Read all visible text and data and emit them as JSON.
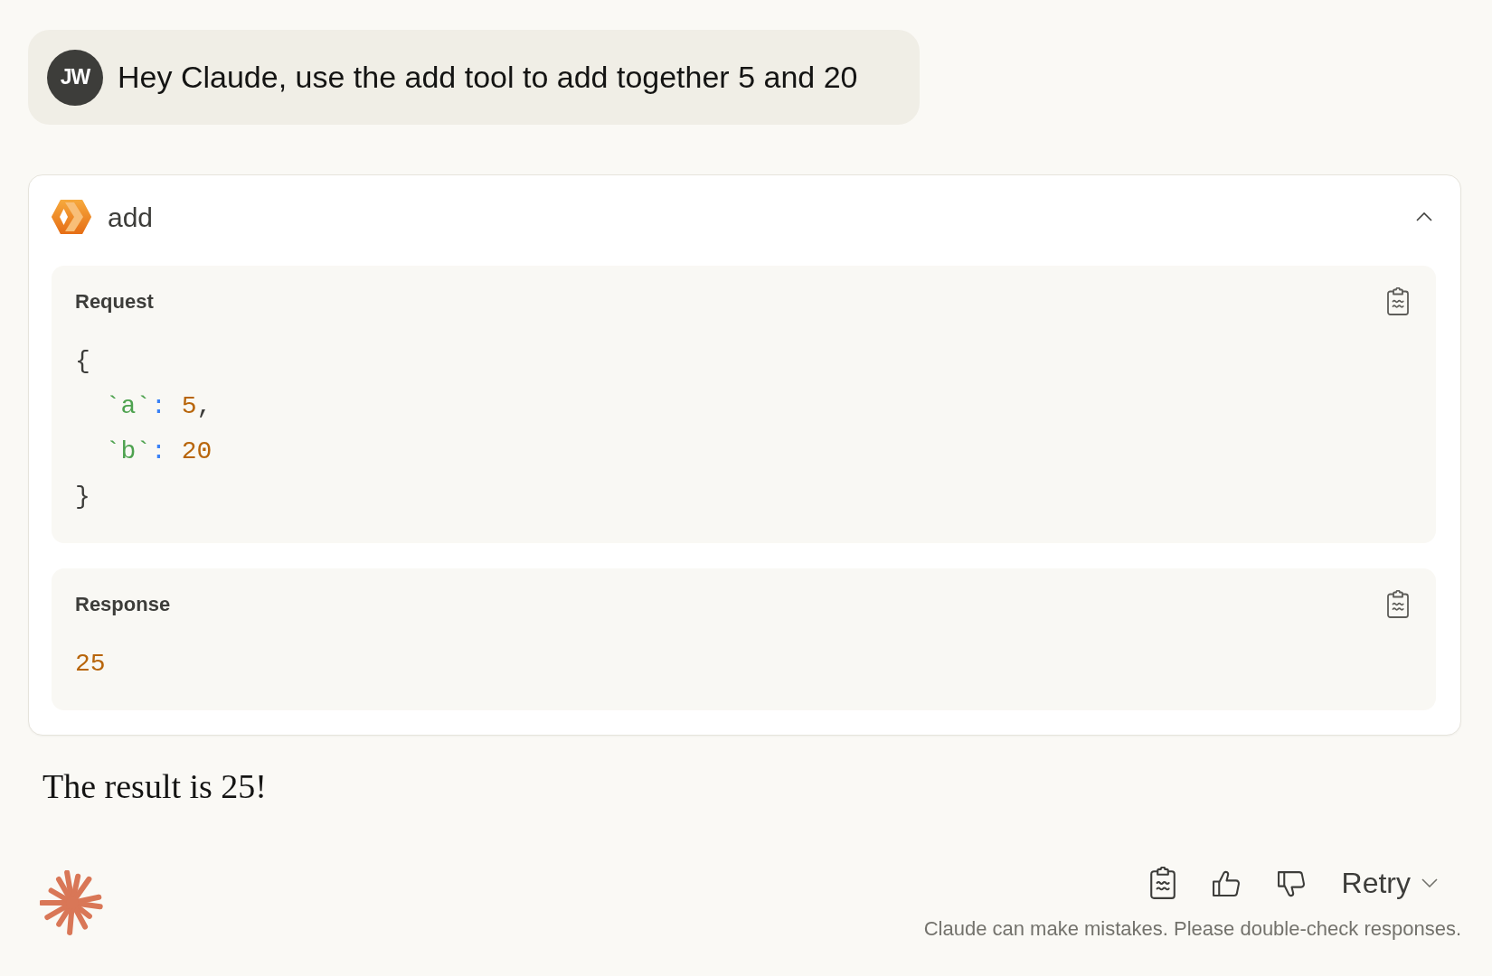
{
  "user_message": {
    "avatar_initials": "JW",
    "text": "Hey Claude, use the add tool to add together 5 and 20"
  },
  "tool_call": {
    "name": "add",
    "expanded": true,
    "sections": [
      {
        "kind": "json",
        "label": "Request",
        "open": "{",
        "fields": [
          {
            "key": "`a`",
            "separator": ":",
            "value": "5",
            "trailing": ","
          },
          {
            "key": "`b`",
            "separator": ":",
            "value": "20"
          }
        ],
        "close": "}"
      },
      {
        "kind": "value",
        "label": "Response",
        "value": "25"
      }
    ]
  },
  "reply": {
    "text": "The result is 25!"
  },
  "actions": {
    "retry_label": "Retry"
  },
  "disclaimer": "Claude can make mistakes. Please double-check responses."
}
